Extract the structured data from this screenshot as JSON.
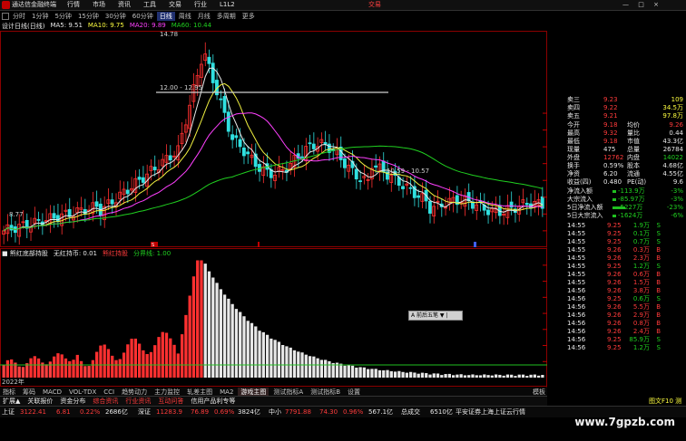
{
  "titlebar": {
    "app_name": "通达信金融终端",
    "menu": [
      "行情",
      "市场",
      "资讯",
      "工具",
      "交易",
      "行业",
      "L1L2"
    ],
    "trade_label": "交易",
    "win_buttons": "— □ ×"
  },
  "periodbar": {
    "items": [
      "分时",
      "1分钟",
      "5分钟",
      "15分钟",
      "30分钟",
      "60分钟",
      "日线",
      "周线",
      "月线",
      "多周期",
      "更多"
    ],
    "active_index": 6
  },
  "ma_line": {
    "label": "设计日线(日线)",
    "ma5": "MA5: 9.51",
    "ma10": "MA10: 9.75",
    "ma20": "MA20: 9.89",
    "ma60": "MA60: 10.44"
  },
  "main_chart": {
    "high_label": "14.78",
    "low_label": "8.77",
    "range1_label": "12.00 - 12.95",
    "range2_label": "10.59 - 10.57",
    "price_axis": [
      "12.50",
      "12.00",
      "11.50",
      "11.00",
      "10.50",
      "10.00",
      "9.50",
      "9.00"
    ],
    "price_min": 8.7,
    "price_max": 14.9,
    "marker_label": "S"
  },
  "indicator": {
    "header": "■ 熊红底部持股",
    "name": "无红持币: 0.01",
    "val2": "熊红持股",
    "val3": "分界线: 1.00",
    "axis": [
      "7.00",
      "6.00",
      "5.00",
      "4.00",
      "3.00",
      "2.00",
      "1.00"
    ],
    "year_label": "2022年"
  },
  "popup_label": "A 前后五笔 ▼ |",
  "right_panel": {
    "order_book": [
      {
        "label": "卖三",
        "price": "9.23",
        "vol": "109"
      },
      {
        "label": "卖四",
        "price": "9.22",
        "vol": "34.5万"
      },
      {
        "label": "卖五",
        "price": "9.21",
        "vol": "97.8万"
      }
    ],
    "quote": [
      {
        "l1": "今开",
        "v1": "9.18",
        "l2": "均价",
        "v2": "9.26"
      },
      {
        "l1": "最高",
        "v1": "9.32",
        "l2": "量比",
        "v2": "0.44"
      },
      {
        "l1": "最低",
        "v1": "9.18",
        "l2": "市值",
        "v2": "43.3亿"
      },
      {
        "l1": "现量",
        "v1": "475",
        "l2": "总量",
        "v2": "26784"
      },
      {
        "l1": "外盘",
        "v1": "12762",
        "l2": "内盘",
        "v2": "14022"
      },
      {
        "l1": "换手",
        "v1": "0.59%",
        "l2": "股本",
        "v2": "4.68亿"
      },
      {
        "l1": "净资",
        "v1": "6.20",
        "l2": "流通",
        "v2": "4.55亿"
      },
      {
        "l1": "收益(四)",
        "v1": "0.480",
        "l2": "PE(动)",
        "v2": "9.6"
      }
    ],
    "flows": [
      {
        "label": "净流入额",
        "value": "-113.9万",
        "pct": "-3%"
      },
      {
        "label": "大宗流入",
        "value": "-85.97万",
        "pct": "-3%"
      },
      {
        "label": "5日净流入额",
        "value": "-5227万",
        "pct": "-23%"
      },
      {
        "label": "5日大宗流入",
        "value": "-1624万",
        "pct": "-6%"
      }
    ],
    "ticks": [
      {
        "t": "14:55",
        "p": "9.25",
        "v": "1.9万",
        "d": "S"
      },
      {
        "t": "14:55",
        "p": "9.25",
        "v": "0.1万",
        "d": "S"
      },
      {
        "t": "14:55",
        "p": "9.25",
        "v": "0.7万",
        "d": "S"
      },
      {
        "t": "14:55",
        "p": "9.26",
        "v": "0.3万",
        "d": "B"
      },
      {
        "t": "14:55",
        "p": "9.26",
        "v": "2.3万",
        "d": "B"
      },
      {
        "t": "14:55",
        "p": "9.25",
        "v": "1.2万",
        "d": "S"
      },
      {
        "t": "14:55",
        "p": "9.26",
        "v": "0.6万",
        "d": "B"
      },
      {
        "t": "14:55",
        "p": "9.26",
        "v": "1.5万",
        "d": "B"
      },
      {
        "t": "14:56",
        "p": "9.26",
        "v": "3.8万",
        "d": "B"
      },
      {
        "t": "14:56",
        "p": "9.25",
        "v": "0.6万",
        "d": "S"
      },
      {
        "t": "14:56",
        "p": "9.26",
        "v": "5.5万",
        "d": "B"
      },
      {
        "t": "14:56",
        "p": "9.26",
        "v": "2.9万",
        "d": "B"
      },
      {
        "t": "14:56",
        "p": "9.26",
        "v": "0.8万",
        "d": "B"
      },
      {
        "t": "14:56",
        "p": "9.26",
        "v": "2.4万",
        "d": "B"
      },
      {
        "t": "14:56",
        "p": "9.25",
        "v": "85.9万",
        "d": "S"
      },
      {
        "t": "14:56",
        "p": "9.25",
        "v": "1.2万",
        "d": "S"
      }
    ]
  },
  "indicator_tabs": {
    "items": [
      "指标",
      "筹码",
      "MACD",
      "VOL-TDX",
      "CCI",
      "趋势动力",
      "主力监控",
      "轧差主图",
      "MA2",
      "游戏主图",
      "测试指标A",
      "测试指标B",
      "设置"
    ],
    "active_index": 9
  },
  "sub_tabs": [
    "扩展▲",
    "关联报价",
    "资金分布",
    "综合资讯",
    "行业资讯",
    "互动问答",
    "信用产品利专等"
  ],
  "status": {
    "idx1_name": "上证",
    "idx1_val": "3122.41",
    "idx1_chg": "6.81",
    "idx1_pct": "0.22%",
    "idx1_amt": "2686亿",
    "idx2_name": "深证",
    "idx2_val": "11283.9",
    "idx2_chg": "76.89",
    "idx2_pct": "0.69%",
    "idx2_amt": "3824亿",
    "idx3_name": "中小",
    "idx3_val": "7791.88",
    "idx3_chg": "74.30",
    "idx3_pct": "0.96%",
    "idx3_amt": "567.1亿",
    "total_label": "总成交",
    "total_val": "6510亿",
    "notice": "平安证券上海上证云行情"
  },
  "right_tab_label": "模板",
  "right_tab_label2": "图文F10 测",
  "watermark": "www.7gpzb.com"
}
